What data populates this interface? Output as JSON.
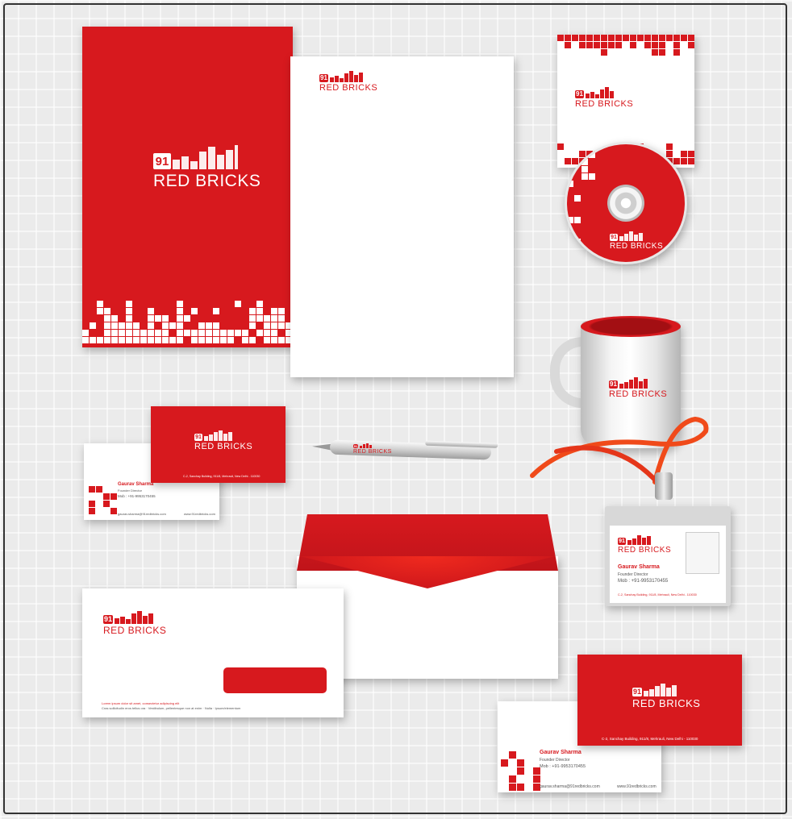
{
  "brand": {
    "badge": "91",
    "name": "RED BRICKS",
    "primary_color": "#d7191e",
    "dark_red": "#b31217"
  },
  "person": {
    "name": "Gaurav Sharma",
    "title": "Founder Director",
    "mobile": "Mob : +91-9953170455",
    "email": "gaurav.sharma@91redbricks.com",
    "website": "www.91redbricks.com",
    "address": "C-2, Sanchay Building, 911/8, Mehrauli, New Delhi - 110030"
  },
  "envelope_footer": {
    "line1": "Lorem ipsum dolor sit amet, consectetur adipiscing elit",
    "line2": "Cras sollicitudin eros tellus ora · Vestibulum, pellentesque non at enim · Nulla · Ipsum/elementum"
  },
  "items": {
    "folder": "folder",
    "letterhead": "letterhead",
    "notepad": "notepad",
    "cd": "cd",
    "mug": "mug",
    "pen": "pen",
    "id_card": "id-card",
    "envelope": "envelope"
  }
}
